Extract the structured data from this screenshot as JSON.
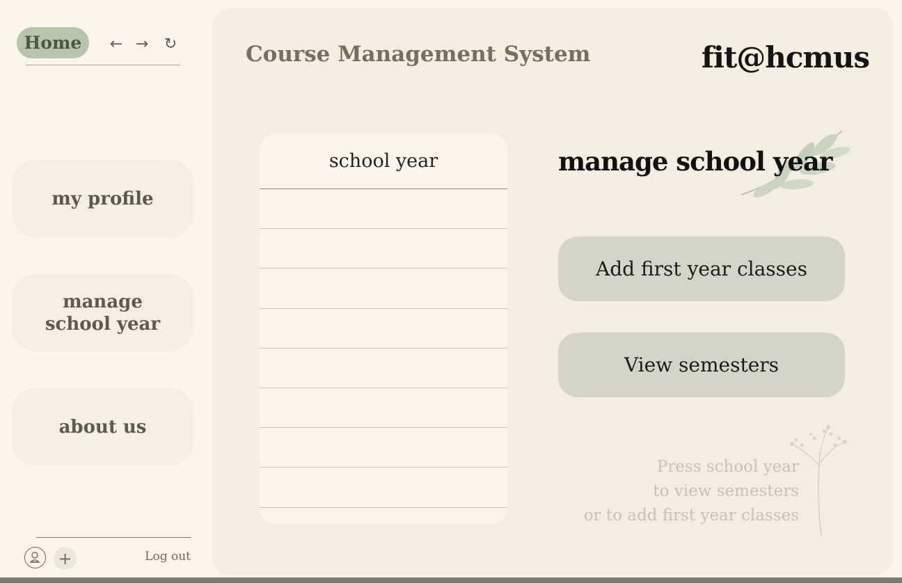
{
  "nav": {
    "home_label": "Home",
    "back_icon": "←",
    "forward_icon": "→",
    "reload_icon": "↻"
  },
  "sidebar": {
    "items": [
      {
        "label": "my profile"
      },
      {
        "label": "manage\nschool year"
      },
      {
        "label": "about us"
      }
    ],
    "plus_icon": "+",
    "logout_label": "Log out"
  },
  "header": {
    "app_title": "Course Management System",
    "brand": "fit@hcmus"
  },
  "school_year_table": {
    "header": "school year",
    "rows": [
      "",
      "",
      "",
      "",
      "",
      "",
      "",
      "",
      ""
    ]
  },
  "section": {
    "title": "manage school year"
  },
  "actions": {
    "add_first_year_label": "Add first year classes",
    "view_semesters_label": "View semesters"
  },
  "hint": {
    "text": "Press school year\nto view semesters\nor to add first year classes"
  },
  "colors": {
    "background": "#fcf5ec",
    "panel": "#f4ede2",
    "accent": "#b9c4ad",
    "button": "#d4d5c8",
    "side_button": "#f5eee3"
  }
}
